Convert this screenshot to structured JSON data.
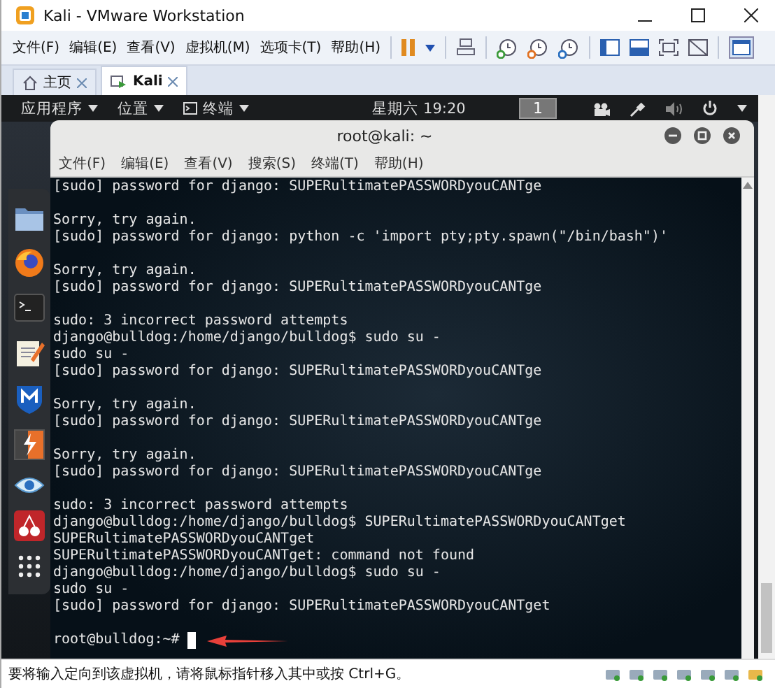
{
  "window": {
    "title": "Kali - VMware Workstation"
  },
  "menu": [
    "文件(F)",
    "编辑(E)",
    "查看(V)",
    "虚拟机(M)",
    "选项卡(T)",
    "帮助(H)"
  ],
  "tabs": [
    {
      "label": "主页",
      "selected": false
    },
    {
      "label": "Kali",
      "selected": true
    }
  ],
  "topbar": {
    "apps": "应用程序",
    "places": "位置",
    "terminal": "终端",
    "clock": "星期六 19:20",
    "workspace": "1"
  },
  "terminal": {
    "title": "root@kali: ~",
    "menu": [
      "文件(F)",
      "编辑(E)",
      "查看(V)",
      "搜索(S)",
      "终端(T)",
      "帮助(H)"
    ],
    "lines": [
      {
        "kind": "text",
        "text": "[sudo] password for django: SUPERultimatePASSWORDyouCANTge"
      },
      {
        "kind": "blank"
      },
      {
        "kind": "text",
        "text": "Sorry, try again."
      },
      {
        "kind": "text",
        "text": "[sudo] password for django: python -c 'import pty;pty.spawn(\"/bin/bash\")'"
      },
      {
        "kind": "blank"
      },
      {
        "kind": "text",
        "text": "Sorry, try again."
      },
      {
        "kind": "text",
        "text": "[sudo] password for django: SUPERultimatePASSWORDyouCANTge"
      },
      {
        "kind": "blank"
      },
      {
        "kind": "text",
        "text": "sudo: 3 incorrect password attempts"
      },
      {
        "kind": "text",
        "text": "django@bulldog:/home/django/bulldog$ sudo su -"
      },
      {
        "kind": "text",
        "text": "sudo su -"
      },
      {
        "kind": "text",
        "text": "[sudo] password for django: SUPERultimatePASSWORDyouCANTge"
      },
      {
        "kind": "blank"
      },
      {
        "kind": "text",
        "text": "Sorry, try again."
      },
      {
        "kind": "text",
        "text": "[sudo] password for django: SUPERultimatePASSWORDyouCANTge"
      },
      {
        "kind": "blank"
      },
      {
        "kind": "text",
        "text": "Sorry, try again."
      },
      {
        "kind": "text",
        "text": "[sudo] password for django: SUPERultimatePASSWORDyouCANTge"
      },
      {
        "kind": "blank"
      },
      {
        "kind": "text",
        "text": "sudo: 3 incorrect password attempts"
      },
      {
        "kind": "text",
        "text": "django@bulldog:/home/django/bulldog$ SUPERultimatePASSWORDyouCANTget"
      },
      {
        "kind": "text",
        "text": "SUPERultimatePASSWORDyouCANTget"
      },
      {
        "kind": "text",
        "text": "SUPERultimatePASSWORDyouCANTget: command not found"
      },
      {
        "kind": "text",
        "text": "django@bulldog:/home/django/bulldog$ sudo su -"
      },
      {
        "kind": "text",
        "text": "sudo su -"
      },
      {
        "kind": "text",
        "text": "[sudo] password for django: SUPERultimatePASSWORDyouCANTget"
      },
      {
        "kind": "blank"
      },
      {
        "kind": "prompt",
        "text": "root@bulldog:~#"
      }
    ]
  },
  "status_bar": {
    "text": "要将输入定向到该虚拟机，请将鼠标指针移入其中或按 Ctrl+G。"
  }
}
